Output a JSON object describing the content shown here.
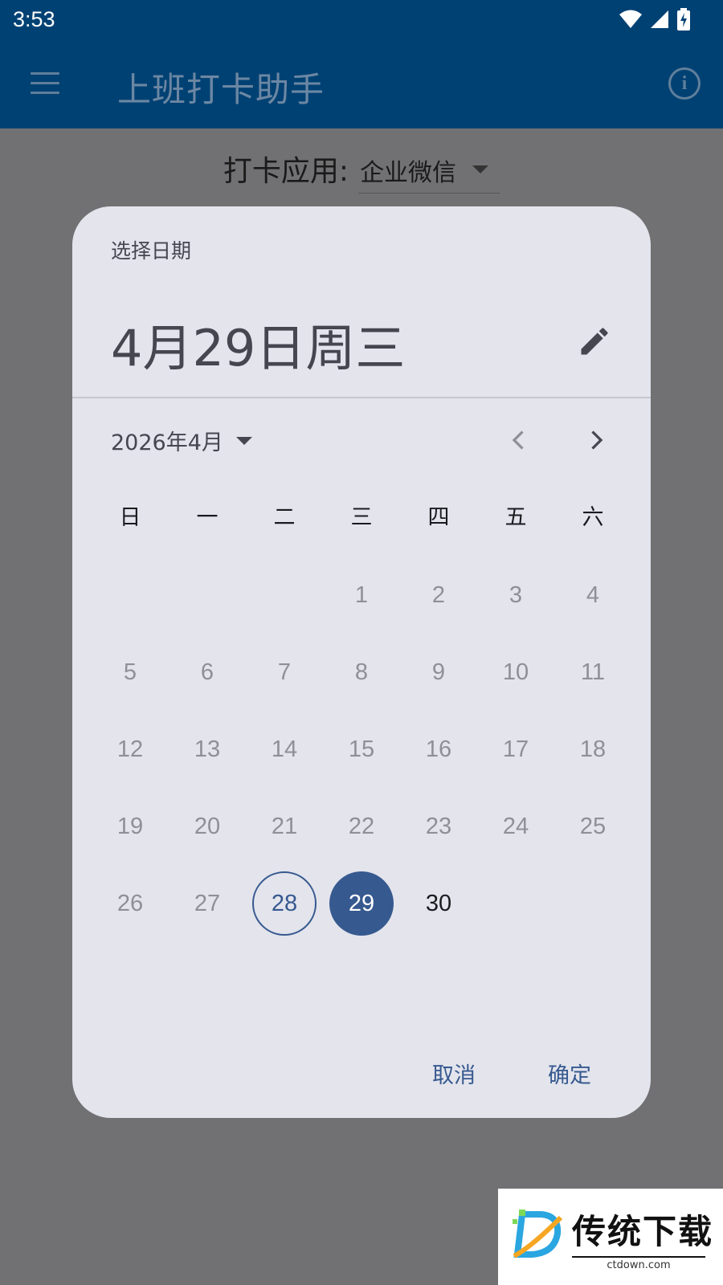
{
  "status_bar": {
    "time": "3:53"
  },
  "app_bar": {
    "title": "上班打卡助手"
  },
  "app_selector": {
    "label": "打卡应用:",
    "value": "企业微信"
  },
  "date_picker": {
    "supporting_text": "选择日期",
    "headline": "4月29日周三",
    "month_label": "2026年4月",
    "weekdays": [
      "日",
      "一",
      "二",
      "三",
      "四",
      "五",
      "六"
    ],
    "days": [
      {
        "label": "",
        "state": "empty"
      },
      {
        "label": "",
        "state": "empty"
      },
      {
        "label": "",
        "state": "empty"
      },
      {
        "label": "1",
        "state": "disabled"
      },
      {
        "label": "2",
        "state": "disabled"
      },
      {
        "label": "3",
        "state": "disabled"
      },
      {
        "label": "4",
        "state": "disabled"
      },
      {
        "label": "5",
        "state": "disabled"
      },
      {
        "label": "6",
        "state": "disabled"
      },
      {
        "label": "7",
        "state": "disabled"
      },
      {
        "label": "8",
        "state": "disabled"
      },
      {
        "label": "9",
        "state": "disabled"
      },
      {
        "label": "10",
        "state": "disabled"
      },
      {
        "label": "11",
        "state": "disabled"
      },
      {
        "label": "12",
        "state": "disabled"
      },
      {
        "label": "13",
        "state": "disabled"
      },
      {
        "label": "14",
        "state": "disabled"
      },
      {
        "label": "15",
        "state": "disabled"
      },
      {
        "label": "16",
        "state": "disabled"
      },
      {
        "label": "17",
        "state": "disabled"
      },
      {
        "label": "18",
        "state": "disabled"
      },
      {
        "label": "19",
        "state": "disabled"
      },
      {
        "label": "20",
        "state": "disabled"
      },
      {
        "label": "21",
        "state": "disabled"
      },
      {
        "label": "22",
        "state": "disabled"
      },
      {
        "label": "23",
        "state": "disabled"
      },
      {
        "label": "24",
        "state": "disabled"
      },
      {
        "label": "25",
        "state": "disabled"
      },
      {
        "label": "26",
        "state": "disabled"
      },
      {
        "label": "27",
        "state": "disabled"
      },
      {
        "label": "28",
        "state": "today"
      },
      {
        "label": "29",
        "state": "selected"
      },
      {
        "label": "30",
        "state": "enabled"
      }
    ],
    "cancel_label": "取消",
    "confirm_label": "确定"
  },
  "watermark": {
    "text": "传统下载",
    "url_text": "ctdown.com"
  },
  "colors": {
    "primary": "#36598f",
    "app_bar": "#004173",
    "dialog_surface": "#e3e4ec",
    "scrim": "#717174"
  },
  "icons": [
    "menu-icon",
    "info-icon",
    "dropdown-arrow-icon",
    "edit-icon",
    "chevron-left-icon",
    "chevron-right-icon",
    "wifi-icon",
    "signal-icon",
    "battery-charging-icon"
  ]
}
